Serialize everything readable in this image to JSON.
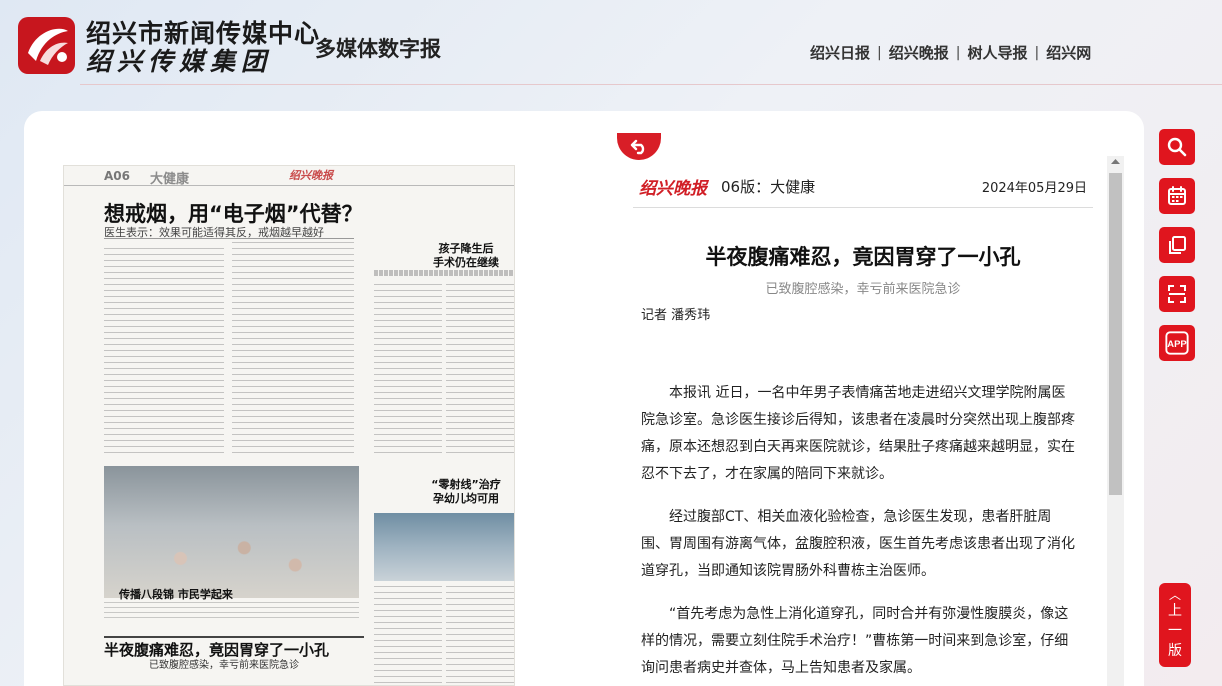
{
  "header": {
    "org_name": "绍兴市新闻传媒中心",
    "group_name": "绍兴传媒集团",
    "product_name": "多媒体数字报",
    "nav": [
      "绍兴日报",
      "绍兴晚报",
      "树人导报",
      "绍兴网"
    ]
  },
  "paper": {
    "page_no": "A06",
    "section": "大健康",
    "brand": "绍兴晚报",
    "lead_title": "想戒烟，用“电子烟”代替？",
    "lead_sub": "医生表示：效果可能适得其反，戒烟越早越好",
    "right_title_1": "孩子降生后",
    "right_title_2": "手术仍在继续",
    "right_title_3": "“零射线”治疗",
    "right_title_4": "孕幼儿均可用",
    "photo_caption": "传播八段锦  市民学起来",
    "bottom_title": "半夜腹痛难忍，竟因胃穿了一小孔",
    "bottom_sub": "已致腹腔感染，幸亏前来医院急诊"
  },
  "article": {
    "brand": "绍兴晚报",
    "edition": "06版：大健康",
    "date": "2024年05月29日",
    "title": "半夜腹痛难忍，竟因胃穿了一小孔",
    "subtitle": "已致腹腔感染，幸亏前来医院急诊",
    "author": "记者 潘秀玮",
    "paragraphs": [
      "本报讯 近日，一名中年男子表情痛苦地走进绍兴文理学院附属医院急诊室。急诊医生接诊后得知，该患者在凌晨时分突然出现上腹部疼痛，原本还想忍到白天再来医院就诊，结果肚子疼痛越来越明显，实在忍不下去了，才在家属的陪同下来就诊。",
      "经过腹部CT、相关血液化验检查，急诊医生发现，患者肝脏周围、胃周围有游离气体，盆腹腔积液，医生首先考虑该患者出现了消化道穿孔，当即通知该院胃肠外科曹栋主治医师。",
      "“首先考虑为急性上消化道穿孔，同时合并有弥漫性腹膜炎，像这样的情况，需要立刻住院手术治疗！”曹栋第一时间来到急诊室，仔细询问患者病史并查体，马上告知患者及家属。"
    ]
  },
  "toolbar": {
    "icons": [
      "search-icon",
      "calendar-icon",
      "copy-icon",
      "scan-icon",
      "app-icon"
    ],
    "app_label": "APP",
    "prev_page_label": "上一版"
  },
  "colors": {
    "brand_red": "#e0151e",
    "article_brand_red": "#d11f26"
  }
}
